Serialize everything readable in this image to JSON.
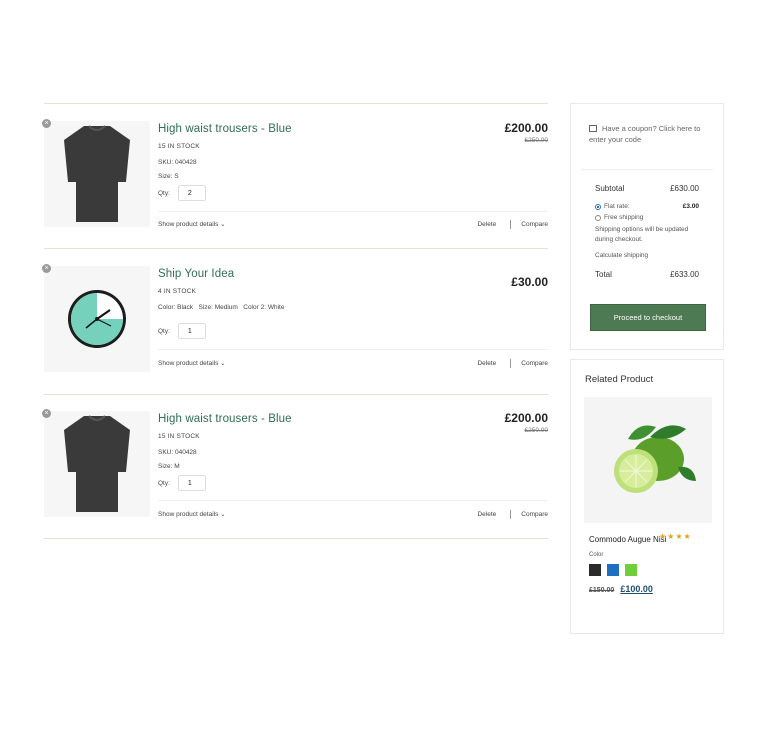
{
  "cart": {
    "items": [
      {
        "name": "High waist trousers - Blue",
        "stock": "15 IN STOCK",
        "attrs": [
          "SKU: 040428",
          "Size: S"
        ],
        "qty_label": "Qty:",
        "qty": "2",
        "price": "£200.00",
        "old_price": "£250.00",
        "details": "Show product details ⌄",
        "delete": "Delete",
        "compare": "Compare",
        "remove_icon": "×"
      },
      {
        "name": "Ship Your Idea",
        "stock": "4 IN STOCK",
        "attrs": [
          "Color: Black   Size: Medium   Color 2: White"
        ],
        "qty_label": "Qty:",
        "qty": "1",
        "price": "£30.00",
        "old_price": "",
        "details": "Show product details ⌄",
        "delete": "Delete",
        "compare": "Compare",
        "remove_icon": "×"
      },
      {
        "name": "High waist trousers - Blue",
        "stock": "15 IN STOCK",
        "attrs": [
          "SKU: 040428",
          "Size: M"
        ],
        "qty_label": "Qty:",
        "qty": "1",
        "price": "£200.00",
        "old_price": "£250.00",
        "details": "Show product details ⌄",
        "delete": "Delete",
        "compare": "Compare",
        "remove_icon": "×"
      }
    ]
  },
  "summary": {
    "coupon_text": "Have a coupon? Click here to enter your code",
    "subtotal_label": "Subtotal",
    "subtotal_value": "£630.00",
    "flat_rate_label": "Flat rate:",
    "flat_rate_value": "£3.00",
    "free_shipping_label": "Free shipping",
    "shipping_note": "Shipping options will be updated during checkout.",
    "calc_shipping": "Calculate shipping",
    "total_label": "Total",
    "total_value": "£633.00",
    "checkout_label": "Proceed to checkout"
  },
  "related": {
    "title": "Related Product",
    "product_name": "Commodo Augue Nisi",
    "stars": "★★★★",
    "color_label": "Color",
    "swatches": [
      "#2b2b2b",
      "#1f6ec2",
      "#6fcf3a"
    ],
    "old_price": "£150.00",
    "new_price": "£100.00"
  },
  "icons": {
    "remove": "remove-icon",
    "coupon": "coupon-icon",
    "dropdown": "chevron-down-icon"
  }
}
